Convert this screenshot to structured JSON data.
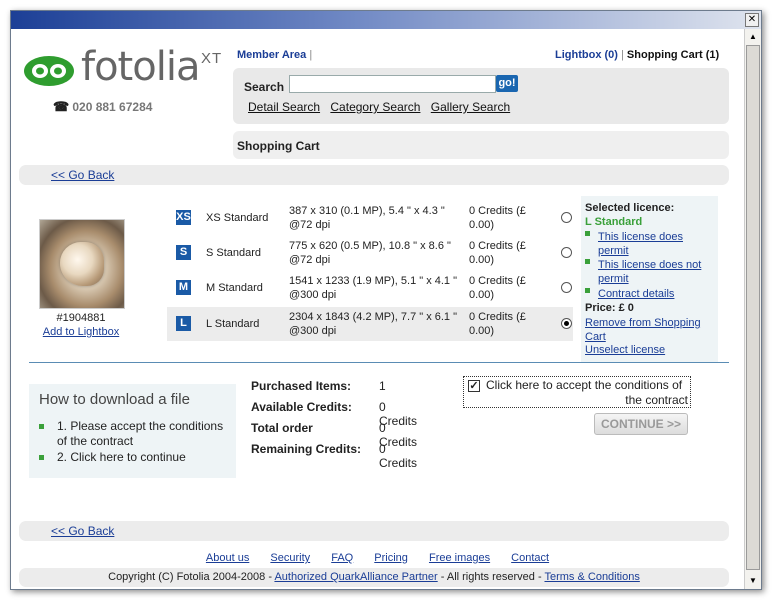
{
  "window": {
    "close_glyph": "✕"
  },
  "brand": {
    "logo_text": "fotolia",
    "logo_suffix": "XT",
    "phone": "020 881 67284"
  },
  "topnav": {
    "member_area": "Member Area",
    "separator": "|",
    "lightbox": "Lightbox (0)",
    "shopping_cart": "Shopping Cart (1)"
  },
  "search": {
    "label": "Search",
    "value": "",
    "go": "go!",
    "links": [
      "Detail Search",
      "Category Search",
      "Gallery Search"
    ]
  },
  "page_title": "Shopping Cart",
  "go_back": "<< Go Back",
  "image": {
    "id": "#1904881",
    "add_to_lightbox": "Add to Lightbox"
  },
  "sizes": [
    {
      "code": "XS",
      "name": "XS Standard",
      "dims": "387 x 310 (0.1 MP), 5.4 \" x 4.3 \" @72 dpi",
      "credits": "0 Credits (£ 0.00)",
      "selected": false
    },
    {
      "code": "S",
      "name": "S Standard",
      "dims": "775 x 620 (0.5 MP), 10.8 \" x 8.6 \" @72 dpi",
      "credits": "0 Credits (£ 0.00)",
      "selected": false
    },
    {
      "code": "M",
      "name": "M Standard",
      "dims": "1541 x 1233 (1.9 MP), 5.1 \" x 4.1 \" @300 dpi",
      "credits": "0 Credits (£ 0.00)",
      "selected": false
    },
    {
      "code": "L",
      "name": "L Standard",
      "dims": "2304 x 1843 (4.2 MP), 7.7 \" x 6.1 \" @300 dpi",
      "credits": "0 Credits (£ 0.00)",
      "selected": true
    }
  ],
  "licence": {
    "heading": "Selected licence:",
    "name": "L Standard",
    "permits": "This license does permit",
    "not_permits": "This license does not permit",
    "contract": "Contract details",
    "price": "Price: £ 0",
    "remove": "Remove from Shopping Cart",
    "unselect": "Unselect license"
  },
  "howto": {
    "title": "How to download a file",
    "step1": "1. Please accept the conditions of the contract",
    "step2": "2. Click here to continue"
  },
  "summary": {
    "purchased_label": "Purchased Items:",
    "purchased_value": "1",
    "available_label": "Available Credits:",
    "available_value": "0 Credits",
    "total_label": "Total order",
    "total_value": "0 Credits",
    "remaining_label": "Remaining Credits:",
    "remaining_value": "0 Credits"
  },
  "accept": {
    "checked": true,
    "line1": "Click here to accept the conditions of",
    "line2": "the contract"
  },
  "continue_label": "CONTINUE >>",
  "footer": {
    "links": [
      "About us",
      "Security",
      "FAQ",
      "Pricing",
      "Free images",
      "Contact"
    ],
    "copyright_prefix": "Copyright (C) Fotolia 2004-2008 -",
    "partner": "Authorized QuarkAlliance Partner",
    "rights": "- All rights reserved -",
    "terms": "Terms & Conditions"
  },
  "colors": {
    "brand_green": "#3aa03a",
    "link_blue": "#1a3d96",
    "badge_blue": "#1a5aa6"
  }
}
